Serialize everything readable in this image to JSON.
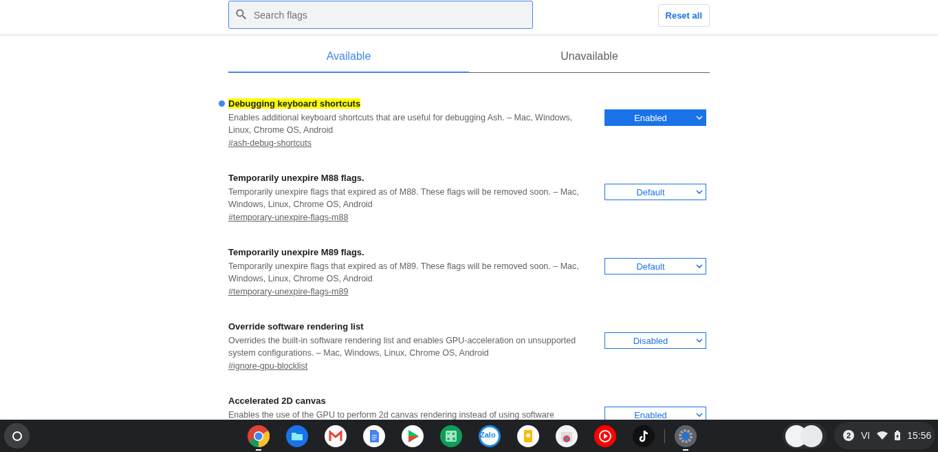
{
  "search": {
    "placeholder": "Search flags"
  },
  "reset_button": "Reset all",
  "tabs": [
    {
      "label": "Available",
      "selected": true
    },
    {
      "label": "Unavailable",
      "selected": false
    }
  ],
  "flags": [
    {
      "title": "Debugging keyboard shortcuts",
      "modified": true,
      "highlighted": true,
      "description": "Enables additional keyboard shortcuts that are useful for debugging Ash. – Mac, Windows, Linux, Chrome OS, Android",
      "link": "#ash-debug-shortcuts",
      "value": "Enabled",
      "selected_nondefault": true
    },
    {
      "title": "Temporarily unexpire M88 flags.",
      "modified": false,
      "highlighted": false,
      "description": "Temporarily unexpire flags that expired as of M88. These flags will be removed soon. – Mac, Windows, Linux, Chrome OS, Android",
      "link": "#temporary-unexpire-flags-m88",
      "value": "Default",
      "selected_nondefault": false
    },
    {
      "title": "Temporarily unexpire M89 flags.",
      "modified": false,
      "highlighted": false,
      "description": "Temporarily unexpire flags that expired as of M89. These flags will be removed soon. – Mac, Windows, Linux, Chrome OS, Android",
      "link": "#temporary-unexpire-flags-m89",
      "value": "Default",
      "selected_nondefault": false
    },
    {
      "title": "Override software rendering list",
      "modified": false,
      "highlighted": false,
      "description": "Overrides the built-in software rendering list and enables GPU-acceleration on unsupported system configurations. – Mac, Windows, Linux, Chrome OS, Android",
      "link": "#ignore-gpu-blocklist",
      "value": "Disabled",
      "selected_nondefault": false
    },
    {
      "title": "Accelerated 2D canvas",
      "modified": false,
      "highlighted": false,
      "description": "Enables the use of the GPU to perform 2d canvas rendering instead of using software",
      "value": "Enabled",
      "selected_nondefault": false
    }
  ],
  "shelf": {
    "apps": [
      {
        "kind": "browser",
        "running": true
      },
      {
        "kind": "files",
        "running": false
      },
      {
        "kind": "mail",
        "running": false
      },
      {
        "kind": "docs",
        "running": false
      },
      {
        "kind": "store",
        "running": false
      },
      {
        "kind": "sheets",
        "running": false
      },
      {
        "kind": "chat",
        "label": "Zalo",
        "running": false
      },
      {
        "kind": "keep",
        "running": false
      },
      {
        "kind": "webstore",
        "running": false
      },
      {
        "kind": "youtube",
        "running": false
      },
      {
        "kind": "tiktok",
        "running": false
      },
      {
        "kind": "settings",
        "running": true
      }
    ],
    "notification_count": "2",
    "input_method": "VI",
    "time": "15:56"
  }
}
